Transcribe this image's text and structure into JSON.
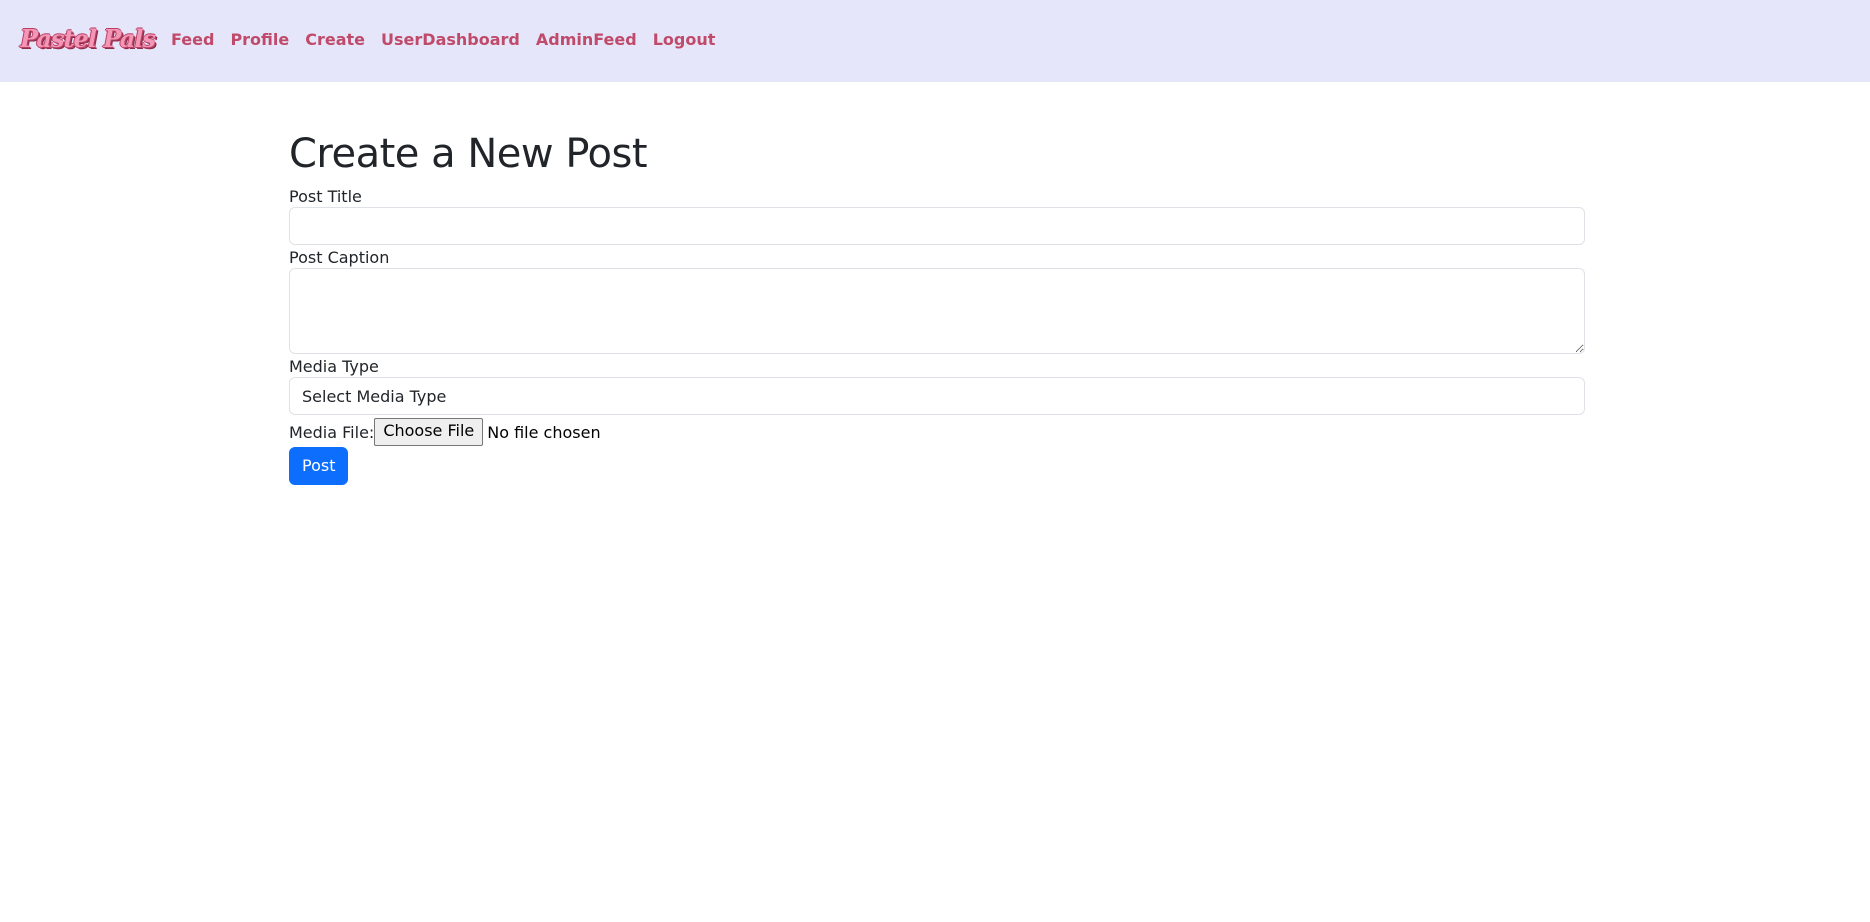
{
  "navbar": {
    "brand": "Pastel Pals",
    "links": [
      "Feed",
      "Profile",
      "Create",
      "UserDashboard",
      "AdminFeed",
      "Logout"
    ]
  },
  "form": {
    "heading": "Create a New Post",
    "title_label": "Post Title",
    "title_value": "",
    "caption_label": "Post Caption",
    "caption_value": "",
    "media_type_label": "Media Type",
    "media_type_selected": "Select Media Type",
    "media_file_label": "Media File:",
    "choose_file_label": "Choose File",
    "file_status": "No file chosen",
    "submit_label": "Post"
  },
  "colors": {
    "navbar_bg": "#e6e6fa",
    "nav_link": "#c04a6a",
    "brand": "#f497b6",
    "primary": "#0d6efd"
  }
}
